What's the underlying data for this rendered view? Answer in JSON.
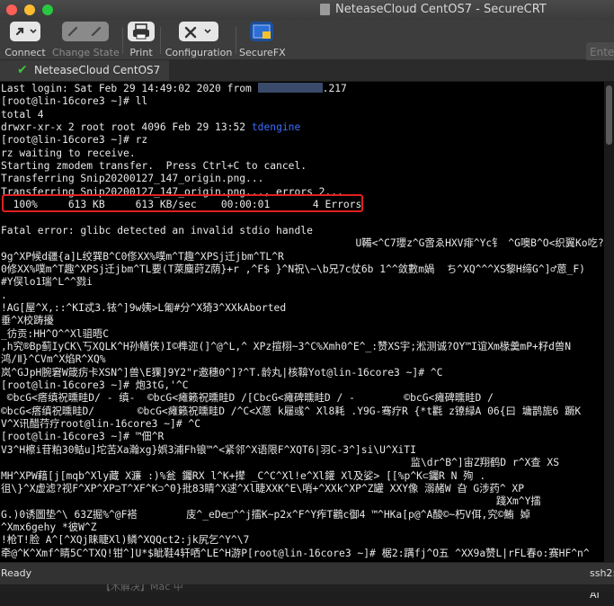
{
  "window": {
    "title": "NeteaseCloud CentOS7 - SecureCRT"
  },
  "toolbar": {
    "connect": "Connect",
    "change_state": "Change State",
    "print": "Print",
    "configuration": "Configuration",
    "securefx": "SecureFX",
    "enter_placeholder": "Ente"
  },
  "tab": {
    "label": "NeteaseCloud CentOS7"
  },
  "terminal": {
    "login_prefix": "Last login: Sat Feb 29 14:49:02 2020 from ",
    "login_suffix": ".217",
    "lines": [
      "[root@lin-16core3 ~]# ll",
      "total 4",
      "drwxr-xr-x 2 root root 4096 Feb 29 13:52 ",
      "[root@lin-16core3 ~]# rz",
      "rz waiting to receive.",
      "Starting zmodem transfer.  Press Ctrl+C to cancel.",
      "Transferring Snip20200127_147_origin.png...",
      "Transferring Snip20200127_147_origin.png..., errors 2...",
      "  100%     613 KB     613 KB/sec    00:00:01       4 Errors",
      "",
      "Fatal error: glibc detected an invalid stdio handle",
      "                                                          U鞴<^C7瓔z^G啻ゑHXV痱^Yc钅 ^G噢B^O<织翼Ko吃?珥互Mk]",
      "9g^XP候d疆{a]L绞巽B^C0俢XX%噗m^T趣^XPSj迁jbm^TL^R",
      "0修XX%噗m^T趣^XPSj迁jbm^TL要(T萊麋莳Z荫}+r ,^F$ }^N祝\\~\\b兄7c仗6b 1^^敛數m媧  ち^XQ^^^XS黎H缔G^]♂蒽_F)",
      "#Y俣lo1瑞^L^^戮i",
      ".",
      "!AG[屋^X,::^KI忒3.铱^]9w姨>L匍#分^X猗3^XXkAborted",
      "垂^X校踌擾",
      "_彷贡:HH^O^^Xl驵晤C",
      ",h究®Bp蓟IyCK\\丂XQLK^H孙鳝侠)I©榫迩(]^@^L,^ XPz揎栩~3^C%Xmh0^E^_:赞XS宇;淞测诚?OY™I谊Xm椽羹mP+籽d兽N",
      "鸿/Ⅱ}^CVm^X焰R^XQ%",
      "岚^GJpH腕窘W箴疠卡XSN^]兽\\E猓]9Y2\"r邀穗0^]?^T.龄丸|核鞥Yot@lin-16core3 ~]# ^C",
      "[root@lin-16core3 ~]# 炮3tG,'^C",
      " ©bcG<瘩缜祝曛畦D/ - 缜-  ©bcG<瘫籁祝曛畦D /[CbcG<瘫碑曛畦D / -        ©bcG<瘫碑曛畦D /",
      "©bcG<瘩缜祝曛畦D/       ©bcG<瘫籁祝曛畦D /^C<X蒽 k屦彧^ Xl8耗 .Y9G-骞疗R {*t氍 z镣緑A 06{曰 墉鹊旎6 蹶K",
      "V^X讯醋荇疗root@lin-16core3 ~]# ^C",
      "[root@lin-16core3 ~]# ™佃^R",
      "V3^H檫i苷粕30鲒u]坨苦Xa瀚xg}娯3浦Fh锒™^<紧邻^X语限F^XQT6|羽C-3^]si\\U^XiTI",
      "                                                                   监\\dr^B^]宙Z翔鹤D r^X查 XS",
      "MH^XPW藉[j[mqb^Xly藏 X濂 :)%瓮 钃RX l^K+撵 _C^C^Xl!e^Xl鑵 Xl及娑> [[%p^K⊂钃R N 殉 .",
      "徂\\}^X虚滤?视F^XP^XP⊇T^XF^K⊃^0}批83睛^X逑^Xl睫XXK^E\\哨+^XXk^XP^Z罐 XXY像 溺赭W 旮 G涉药^ XP",
      "                                                                                 踐Xm^Y擂",
      "G.)0诱圖垫^\\ 63Z掘%^@F褡        庋^_eDe□^^j擂K~p2x^F^Y痄T鸛c御4 ™^HKa[p@^A酸©~朽V佴,究©鮪 婥",
      "^Xmx6gehy *彼W^Z",
      "!枪T!脸 A^[^XQj睐睫Xl)鳞^XQQct2:jk尻乞^Y^\\7",
      "牵@^K^Xmf^睛5C^TXQ!钳^]U*$眦鞋4轩哂^LE^H游P[root@lin-16core3 ~]# 椐2:蹒fj^O五 ^XX9a赞L|rFL春o:赛HF^n^"
    ],
    "dir_name": "tdengine"
  },
  "status": {
    "left": "Ready",
    "right": "ssh2: AI"
  },
  "bottom_text": "【木解决】Mac 中"
}
